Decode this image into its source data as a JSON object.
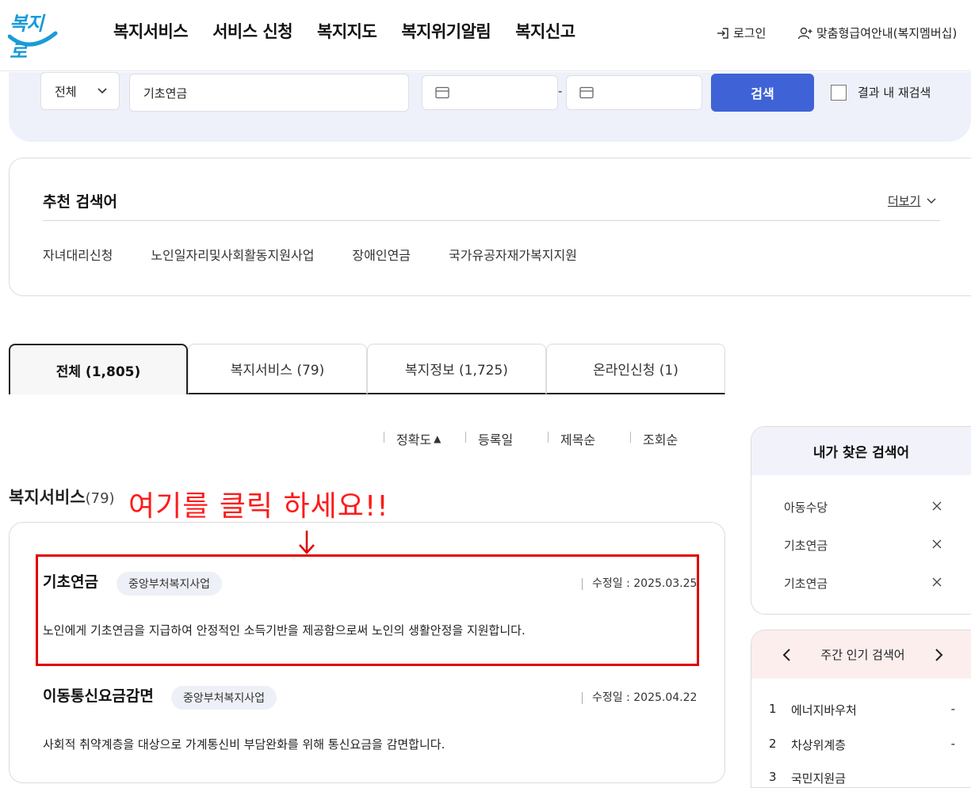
{
  "header": {
    "logo_text": "복지로",
    "nav": [
      "복지서비스",
      "서비스 신청",
      "복지지도",
      "복지위기알림",
      "복지신고"
    ],
    "login_label": "로그인",
    "member_label": "맞춤형급여안내(복지멤버십)"
  },
  "search": {
    "scope_selected": "전체",
    "keyword": "기초연금",
    "date_separator": "-",
    "button_label": "검색",
    "re_search_label": "결과 내 재검색"
  },
  "recommended": {
    "title": "추천 검색어",
    "more_label": "더보기",
    "keywords": [
      "자녀대리신청",
      "노인일자리및사회활동지원사업",
      "장애인연금",
      "국가유공자재가복지지원"
    ]
  },
  "tabs": [
    {
      "label": "전체  (1,805)",
      "active": true
    },
    {
      "label": "복지서비스 (79)",
      "active": false
    },
    {
      "label": "복지정보 (1,725)",
      "active": false
    },
    {
      "label": "온라인신청 (1)",
      "active": false
    }
  ],
  "sort": {
    "options": [
      "정확도",
      "등록일",
      "제목순",
      "조회순"
    ],
    "active_marker": "▲"
  },
  "section": {
    "title": "복지서비스",
    "count": "(79)"
  },
  "annotation": {
    "text": "여기를 클릭 하세요!!",
    "color": "#ff1a1a"
  },
  "results": [
    {
      "title": "기초연금",
      "badge": "중앙부처복지사업",
      "date": "수정일 : 2025.03.25",
      "desc": "노인에게 기초연금을 지급하여 안정적인 소득기반을 제공함으로써 노인의 생활안정을 지원합니다."
    },
    {
      "title": "이동통신요금감면",
      "badge": "중앙부처복지사업",
      "date": "수정일 : 2025.04.22",
      "desc": "사회적 취약계층을 대상으로 가계통신비 부담완화를 위해 통신요금을 감면합니다."
    }
  ],
  "my_searches": {
    "title": "내가 찾은 검색어",
    "items": [
      "아동수당",
      "기초연금",
      "기초연금"
    ]
  },
  "popular": {
    "title": "주간 인기 검색어",
    "items": [
      {
        "rank": "1",
        "label": "에너지바우처",
        "trend": "-"
      },
      {
        "rank": "2",
        "label": "차상위계층",
        "trend": "-"
      },
      {
        "rank": "3",
        "label": "국민지원금",
        "trend": ""
      }
    ]
  },
  "colors": {
    "accent": "#3f63d6",
    "band": "#eef1f9",
    "highlight_border": "#e00000"
  }
}
